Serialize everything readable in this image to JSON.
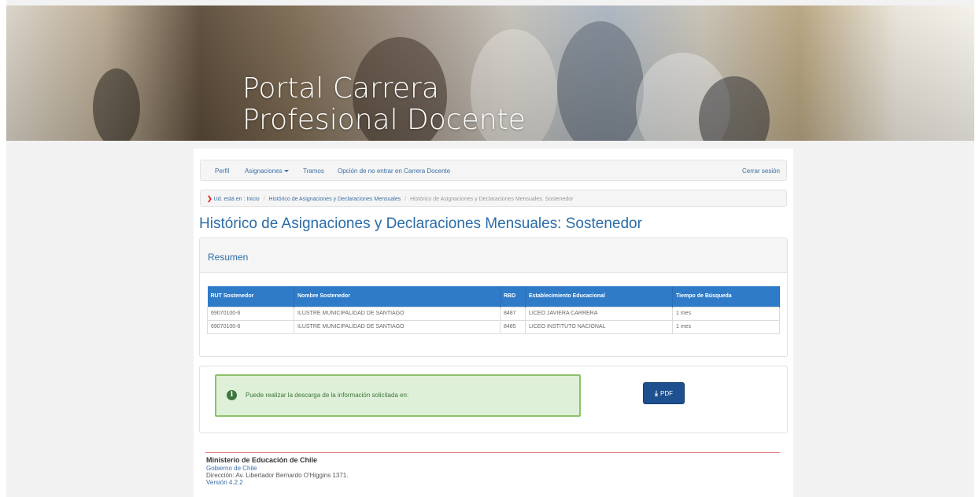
{
  "banner": {
    "title_line1": "Portal Carrera",
    "title_line2": "Profesional Docente"
  },
  "nav": {
    "items": [
      "Perfil",
      "Asignaciones",
      "Tramos",
      "Opción de no entrar en Carrera Docente"
    ],
    "logout": "Cerrar sesión"
  },
  "breadcrumb": {
    "prefix": "Ud. está en :",
    "items": [
      "Inicio",
      "Histórico de Asignaciones y Declaraciones Mensuales",
      "Histórico de Asignaciones y Declaraciones Mensuales: Sostenedor"
    ]
  },
  "page": {
    "title": "Histórico de Asignaciones y Declaraciones Mensuales: Sostenedor"
  },
  "summary": {
    "heading": "Resumen",
    "columns": [
      "RUT Sostenedor",
      "Nombre Sostenedor",
      "RBD",
      "Establecimiento Educacional",
      "Tiempo de Búsqueda"
    ],
    "rows": [
      [
        "69070100-6",
        "ILUSTRE MUNICIPALIDAD DE SANTIAGO",
        "8487",
        "LICEO JAVIERA CARRERA",
        "1 mes"
      ],
      [
        "69070100-6",
        "ILUSTRE MUNICIPALIDAD DE SANTIAGO",
        "8485",
        "LICEO INSTITUTO NACIONAL",
        "1 mes"
      ]
    ]
  },
  "download": {
    "message": "Puede realizar la descarga de la información solicitada en:",
    "pdf_label": "PDF"
  },
  "footer": {
    "ministry": "Ministerio de Educación de Chile",
    "gobierno": "Gobierno de Chile",
    "address": "Dirección: Av. Libertador Bernardo O'Higgins 1371.",
    "version": "Versión 4.2.2"
  },
  "colors": {
    "accent": "#2a6ca8",
    "table_header": "#2f7bc8",
    "success_bg": "#dff0d8",
    "success_border": "#8dc26a",
    "button": "#1e4f8e",
    "breadcrumb_marker": "#e0261b"
  }
}
